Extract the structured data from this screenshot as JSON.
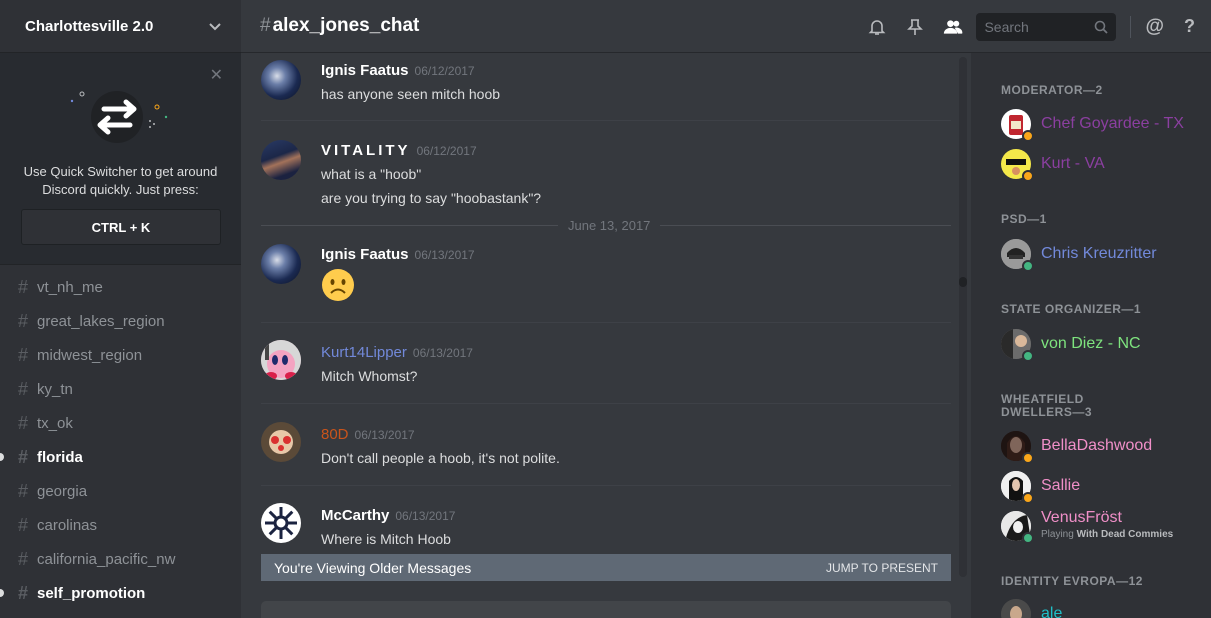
{
  "server": {
    "name": "Charlottesville 2.0"
  },
  "quick_switcher": {
    "text": "Use Quick Switcher to get around Discord quickly. Just press:",
    "shortcut": "CTRL + K"
  },
  "channels": [
    {
      "name": "vt_nh_me",
      "unread": false
    },
    {
      "name": "great_lakes_region",
      "unread": false
    },
    {
      "name": "midwest_region",
      "unread": false
    },
    {
      "name": "ky_tn",
      "unread": false
    },
    {
      "name": "tx_ok",
      "unread": false
    },
    {
      "name": "florida",
      "unread": true
    },
    {
      "name": "georgia",
      "unread": false
    },
    {
      "name": "carolinas",
      "unread": false
    },
    {
      "name": "california_pacific_nw",
      "unread": false
    },
    {
      "name": "self_promotion",
      "unread": true
    }
  ],
  "header": {
    "hash": "#",
    "channel": "alex_jones_chat",
    "search_placeholder": "Search"
  },
  "messages": [
    {
      "author": "Ignis Faatus",
      "color": "#ffffff",
      "time": "06/12/2017",
      "lines": [
        "has anyone seen mitch hoob"
      ]
    },
    {
      "author": "VITALITY",
      "color": "#ffffff",
      "time": "06/12/2017",
      "lines": [
        "what is a \"hoob\"",
        "are you trying to say \"hoobastank\"?"
      ]
    },
    {
      "author": "Ignis Faatus",
      "color": "#ffffff",
      "time": "06/13/2017",
      "lines": []
    },
    {
      "author": "Kurt14Lipper",
      "color": "#7289da",
      "time": "06/13/2017",
      "lines": [
        "Mitch Whomst?"
      ]
    },
    {
      "author": "80D",
      "color": "#c9541b",
      "time": "06/13/2017",
      "lines": [
        "Don't call people a hoob, it's not polite."
      ]
    },
    {
      "author": "McCarthy",
      "color": "#ffffff",
      "time": "06/13/2017",
      "lines": [
        "Where is Mitch Hoob"
      ]
    }
  ],
  "date_divider": "June 13, 2017",
  "older_bar": {
    "text": "You're Viewing Older Messages",
    "action": "JUMP TO PRESENT"
  },
  "roles": [
    {
      "title": "MODERATOR—2",
      "members": [
        {
          "name": "Chef Goyardee - TX",
          "color": "#8b3fa0",
          "status": "#faa61a"
        },
        {
          "name": "Kurt - VA",
          "color": "#8b3fa0",
          "status": "#faa61a"
        }
      ]
    },
    {
      "title": "PSD—1",
      "members": [
        {
          "name": "Chris Kreuzritter",
          "color": "#7289da",
          "status": "#43b581"
        }
      ]
    },
    {
      "title": "STATE ORGANIZER—1",
      "members": [
        {
          "name": "von Diez - NC",
          "color": "#7ee37e",
          "status": "#43b581"
        }
      ]
    },
    {
      "title_line1": "WHEATFIELD",
      "title_line2": "DWELLERS—3",
      "members": [
        {
          "name": "BellaDashwood",
          "color": "#f08fc8",
          "status": "#faa61a"
        },
        {
          "name": "Sallie",
          "color": "#f08fc8",
          "status": "#faa61a"
        },
        {
          "name": "VenusFröst",
          "color": "#f08fc8",
          "status": "#43b581",
          "playing_label": "Playing",
          "playing_game": "With Dead Commies"
        }
      ]
    },
    {
      "title": "IDENTITY EVROPA—12",
      "members": [
        {
          "name": "ale",
          "color": "#1fbfc7",
          "status": "#43b581"
        }
      ]
    }
  ]
}
